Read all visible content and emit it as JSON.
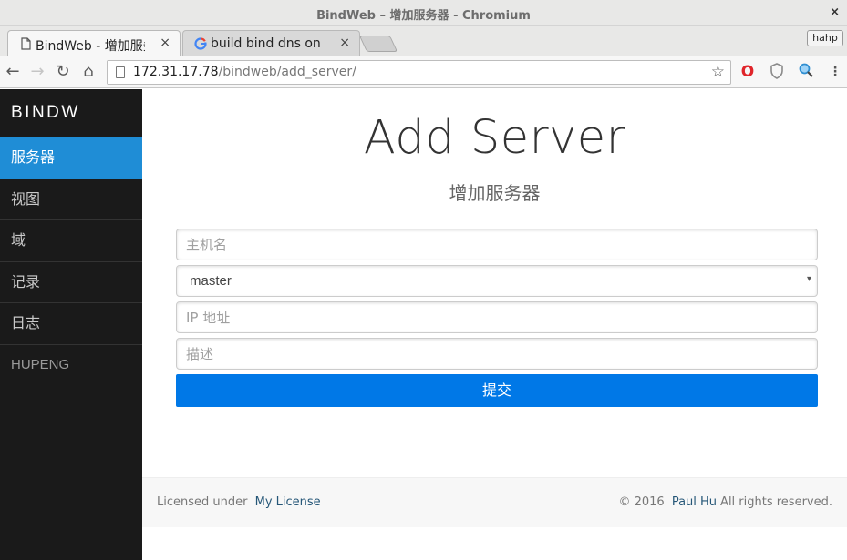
{
  "window": {
    "title": "BindWeb – 增加服务器 - Chromium",
    "close_glyph": "×"
  },
  "tabs": [
    {
      "label": "BindWeb - 增加服务器",
      "icon": "page-icon",
      "close_glyph": "×"
    },
    {
      "label": "build bind dns on",
      "icon": "google-icon",
      "close_glyph": "×"
    }
  ],
  "profile": {
    "label": "hahp"
  },
  "toolbar": {
    "back_glyph": "←",
    "forward_glyph": "→",
    "reload_glyph": "↻",
    "home_glyph": "⌂",
    "url_host": "172.31.17.78",
    "url_path": "/bindweb/add_server/",
    "bookmark_glyph": "☆",
    "menu_glyph": "⋮"
  },
  "sidebar": {
    "brand": "BINDW",
    "items": [
      {
        "label": "服务器",
        "active": true
      },
      {
        "label": "视图",
        "active": false
      },
      {
        "label": "域",
        "active": false
      },
      {
        "label": "记录",
        "active": false
      },
      {
        "label": "日志",
        "active": false
      }
    ],
    "user": "HUPENG"
  },
  "main": {
    "title": "Add Server",
    "subtitle": "增加服务器",
    "form": {
      "hostname_placeholder": "主机名",
      "role_value": "master",
      "role_arrow": "▾",
      "ip_placeholder": "IP 地址",
      "desc_placeholder": "描述",
      "submit_label": "提交"
    }
  },
  "footer": {
    "license_prefix": "Licensed under",
    "license_link": "My License",
    "copyright_prefix": "© 2016",
    "author_link": "Paul Hu",
    "copyright_suffix": "All rights reserved."
  },
  "colors": {
    "sidebar_bg": "#1a1a1a",
    "active_item": "#1f8dd6",
    "primary_button": "#0078e7",
    "link": "#265778"
  }
}
